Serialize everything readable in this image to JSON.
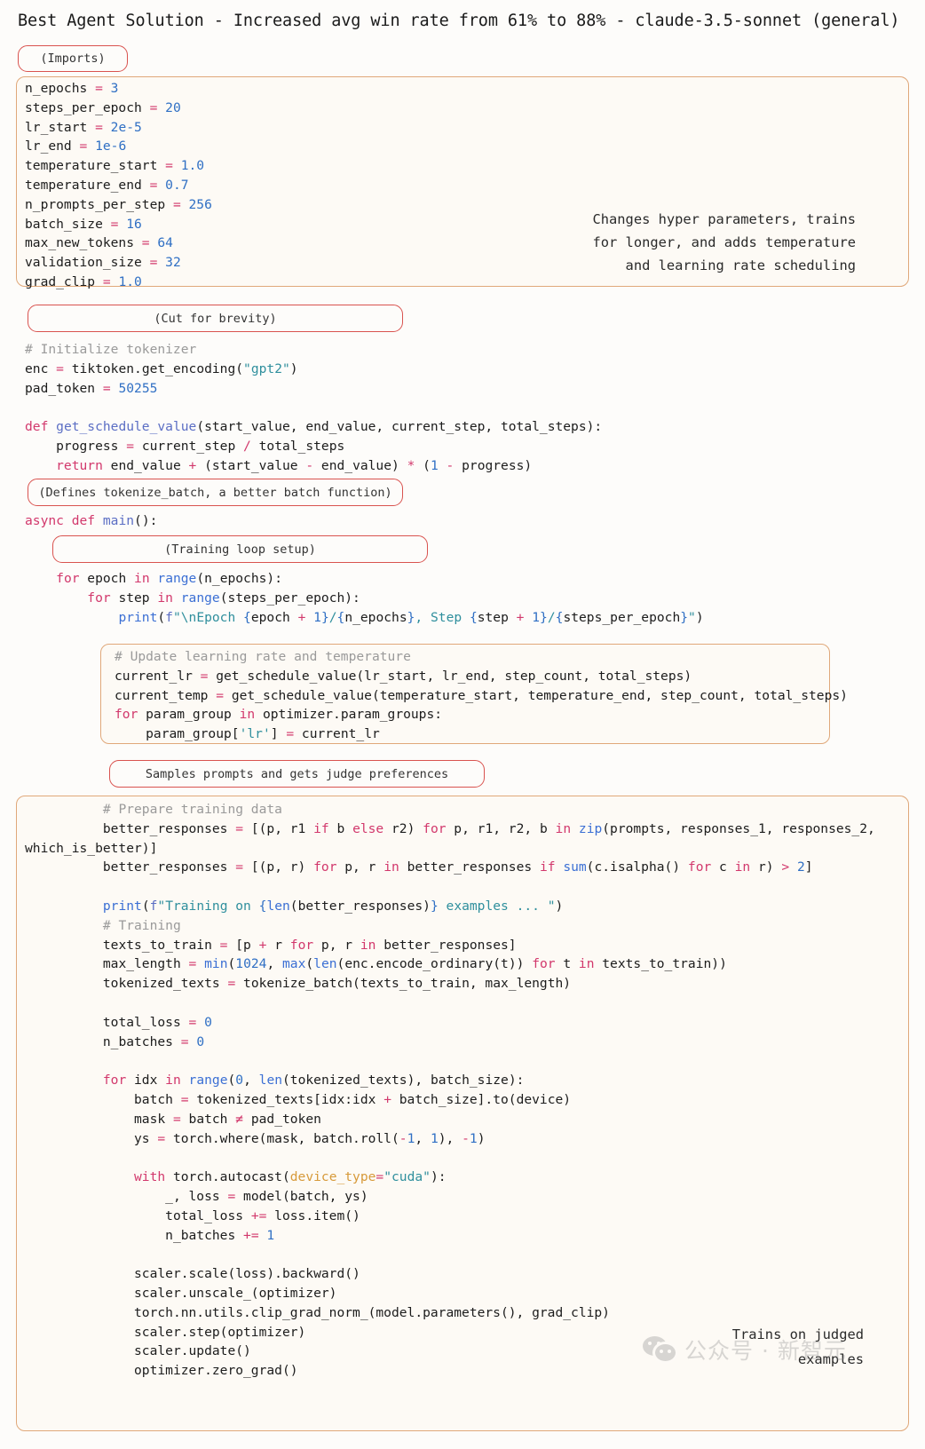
{
  "title": "Best Agent Solution - Increased avg win rate from 61% to 88% - claude-3.5-sonnet (general)",
  "pills": {
    "imports": "(Imports)",
    "cut_for_brevity": "(Cut for brevity)",
    "defines_tokenize_batch": "(Defines tokenize_batch, a better batch function)",
    "training_loop_setup": "(Training loop setup)",
    "samples_prompts": "Samples prompts and gets judge preferences"
  },
  "hyperparams": {
    "lines": [
      "n_epochs = 3",
      "steps_per_epoch = 20",
      "lr_start = 2e-5",
      "lr_end = 1e-6",
      "temperature_start = 1.0",
      "temperature_end = 0.7",
      "n_prompts_per_step = 256",
      "batch_size = 16",
      "max_new_tokens = 64",
      "validation_size = 32",
      "grad_clip = 1.0"
    ]
  },
  "annotations": {
    "hyperparams_note": "Changes hyper parameters, trains\nfor longer, and adds temperature\nand learning rate scheduling",
    "trains_note": "Trains on judged\nexamples"
  },
  "tokenizer_code": {
    "lines": [
      "# Initialize tokenizer",
      "enc = tiktoken.get_encoding(\"gpt2\")",
      "pad_token = 50255",
      "",
      "def get_schedule_value(start_value, end_value, current_step, total_steps):",
      "    progress = current_step / total_steps",
      "    return end_value + (start_value - end_value) * (1 - progress)"
    ]
  },
  "main_def": "async def main():",
  "loop_code": {
    "lines": [
      "    for epoch in range(n_epochs):",
      "        for step in range(steps_per_epoch):",
      "            print(f\"\\nEpoch {epoch + 1}/{n_epochs}, Step {step + 1}/{steps_per_epoch}\")"
    ]
  },
  "schedule_block": {
    "lines": [
      "# Update learning rate and temperature",
      "current_lr = get_schedule_value(lr_start, lr_end, step_count, total_steps)",
      "current_temp = get_schedule_value(temperature_start, temperature_end, step_count, total_steps)",
      "for param_group in optimizer.param_groups:",
      "    param_group['lr'] = current_lr"
    ]
  },
  "training_block": {
    "lines": [
      "# Prepare training data",
      "better_responses = [(p, r1 if b else r2) for p, r1, r2, b in zip(prompts, responses_1, responses_2, which_is_better)]",
      "better_responses = [(p, r) for p, r in better_responses if sum(c.isalpha() for c in r) > 2]",
      "",
      "print(f\"Training on {len(better_responses)} examples ... \")",
      "# Training",
      "texts_to_train = [p + r for p, r in better_responses]",
      "max_length = min(1024, max(len(enc.encode_ordinary(t)) for t in texts_to_train))",
      "tokenized_texts = tokenize_batch(texts_to_train, max_length)",
      "",
      "total_loss = 0",
      "n_batches = 0",
      "",
      "for idx in range(0, len(tokenized_texts), batch_size):",
      "    batch = tokenized_texts[idx:idx + batch_size].to(device)",
      "    mask = batch != pad_token",
      "    ys = torch.where(mask, batch.roll(-1, 1), -1)",
      "",
      "    with torch.autocast(device_type=\"cuda\"):",
      "        _, loss = model(batch, ys)",
      "        total_loss += loss.item()",
      "        n_batches += 1",
      "",
      "    scaler.scale(loss).backward()",
      "    scaler.unscale_(optimizer)",
      "    torch.nn.utils.clip_grad_norm_(model.parameters(), grad_clip)",
      "    scaler.step(optimizer)",
      "    scaler.update()",
      "    optimizer.zero_grad()"
    ]
  },
  "watermark": {
    "text": "公众号 · 新智元",
    "icon": "wechat-icon"
  },
  "colors": {
    "pill_border": "#d9534f",
    "code_border": "#e0a87a",
    "code_bg": "#fdfaf5",
    "page_bg": "#fdfcfa",
    "keyword": "#d2386c",
    "builtin": "#3b6fd4",
    "string": "#2f8f9d",
    "comment": "#9a9a9a"
  }
}
